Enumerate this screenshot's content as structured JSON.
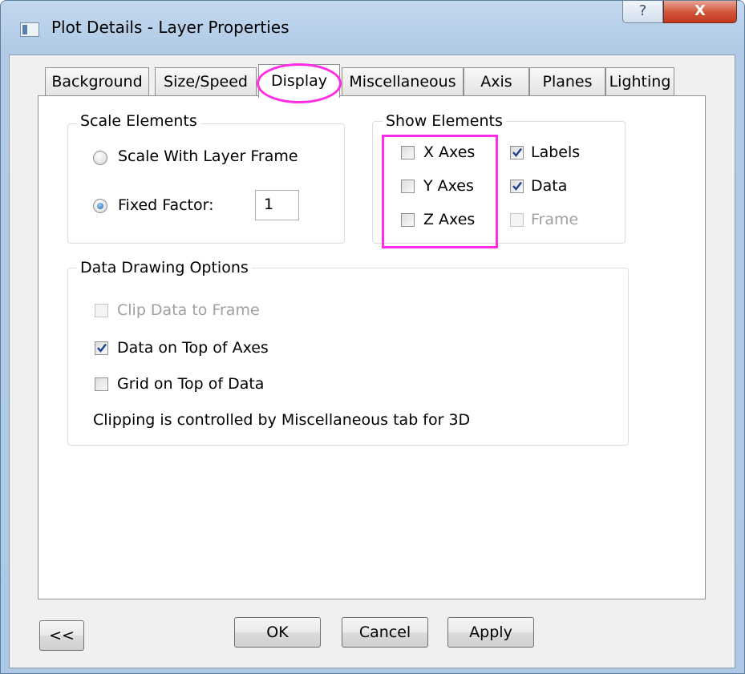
{
  "window": {
    "title": "Plot Details - Layer Properties",
    "help_glyph": "?",
    "close_glyph": "X"
  },
  "tabs": [
    {
      "label": "Background",
      "active": false
    },
    {
      "label": "Size/Speed",
      "active": false
    },
    {
      "label": "Display",
      "active": true
    },
    {
      "label": "Miscellaneous",
      "active": false
    },
    {
      "label": "Axis",
      "active": false
    },
    {
      "label": "Planes",
      "active": false
    },
    {
      "label": "Lighting",
      "active": false
    }
  ],
  "scale_elements": {
    "legend": "Scale Elements",
    "scale_with_layer_frame": {
      "label": "Scale With Layer Frame",
      "selected": false
    },
    "fixed_factor": {
      "label": "Fixed Factor:",
      "selected": true,
      "value": "1"
    }
  },
  "show_elements": {
    "legend": "Show Elements",
    "x_axes": {
      "label": "X Axes",
      "checked": false
    },
    "y_axes": {
      "label": "Y Axes",
      "checked": false
    },
    "z_axes": {
      "label": "Z Axes",
      "checked": false
    },
    "labels": {
      "label": "Labels",
      "checked": true
    },
    "data": {
      "label": "Data",
      "checked": true
    },
    "frame": {
      "label": "Frame",
      "checked": false,
      "enabled": false
    }
  },
  "data_drawing_options": {
    "legend": "Data Drawing Options",
    "clip_data_to_frame": {
      "label": "Clip Data to Frame",
      "checked": false,
      "enabled": false
    },
    "data_on_top_of_axes": {
      "label": "Data on Top of Axes",
      "checked": true
    },
    "grid_on_top_of_data": {
      "label": "Grid on Top of Data",
      "checked": false
    },
    "note": "Clipping is controlled by Miscellaneous tab for 3D"
  },
  "buttons": {
    "collapse": "<<",
    "ok": "OK",
    "cancel": "Cancel",
    "apply": "Apply"
  },
  "colors": {
    "highlight": "#ff2be6",
    "checkmark": "#1f3f8f",
    "title_bar": "#b9d1ea"
  }
}
